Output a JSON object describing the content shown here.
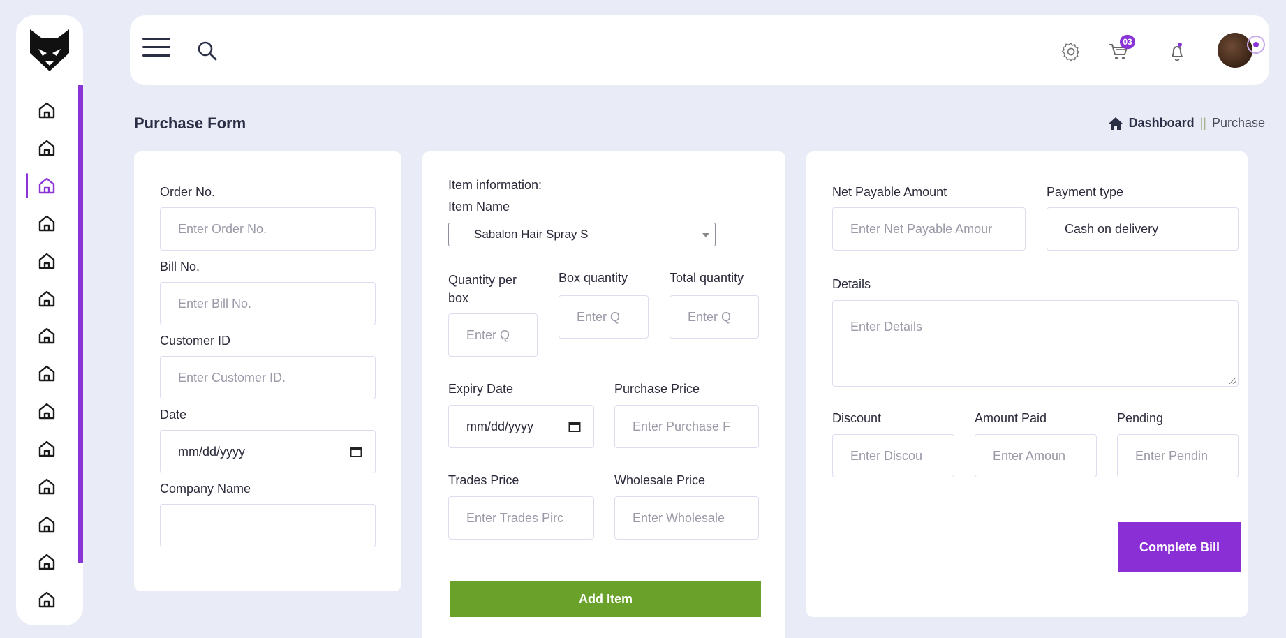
{
  "topbar": {
    "cart_badge": "03"
  },
  "page": {
    "title": "Purchase Form"
  },
  "breadcrumb": {
    "home": "Dashboard",
    "separator": "||",
    "current": "Purchase"
  },
  "left_card": {
    "order_no_label": "Order No.",
    "order_no_placeholder": "Enter Order No.",
    "bill_no_label": "Bill No.",
    "bill_no_placeholder": "Enter Bill No.",
    "customer_id_label": "Customer ID",
    "customer_id_placeholder": "Enter Customer ID.",
    "date_label": "Date",
    "date_placeholder": "mm/dd/yyyy",
    "company_name_label": "Company Name",
    "company_name_value": ""
  },
  "mid_card": {
    "section_title": "Item information:",
    "item_name_label": "Item Name",
    "item_name_value": "Sabalon Hair Spray S",
    "qty_per_box_label": "Quantity per box",
    "qty_per_box_placeholder": "Enter Q",
    "box_qty_label": "Box quantity",
    "box_qty_placeholder": "Enter Q",
    "total_qty_label": "Total quantity",
    "total_qty_placeholder": "Enter Q",
    "expiry_label": "Expiry Date",
    "expiry_placeholder": "mm/dd/yyyy",
    "purchase_price_label": "Purchase Price",
    "purchase_price_placeholder": "Enter Purchase F",
    "trades_price_label": "Trades Price",
    "trades_price_placeholder": "Enter Trades Pirc",
    "wholesale_price_label": "Wholesale Price",
    "wholesale_price_placeholder": "Enter Wholesale",
    "add_item_button": "Add Item"
  },
  "right_card": {
    "net_payable_label": "Net Payable Amount",
    "net_payable_placeholder": "Enter Net Payable Amour",
    "payment_type_label": "Payment type",
    "payment_type_value": "Cash on delivery",
    "details_label": "Details",
    "details_placeholder": "Enter Details",
    "discount_label": "Discount",
    "discount_placeholder": "Enter Discou",
    "amount_paid_label": "Amount Paid",
    "amount_paid_placeholder": "Enter Amoun",
    "pending_label": "Pending",
    "pending_placeholder": "Enter Pendin",
    "complete_bill_button": "Complete Bill"
  },
  "colors": {
    "accent": "#8a2fd6",
    "green": "#6aa12a",
    "background": "#e9ebf7"
  }
}
